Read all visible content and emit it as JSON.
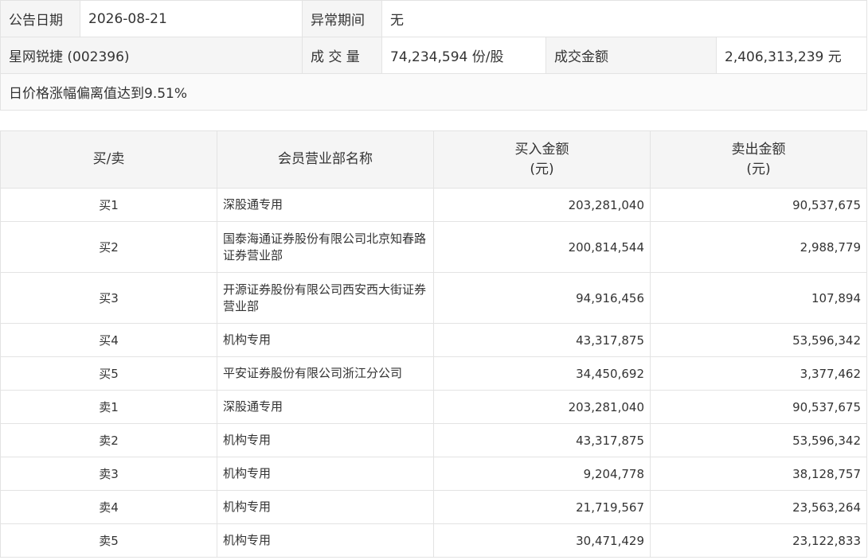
{
  "summary": {
    "date_label": "公告日期",
    "date_value": "2026-08-21",
    "period_label": "异常期间",
    "period_value": "无",
    "stock_name": "星网锐捷 (002396)",
    "volume_label": "成 交 量",
    "volume_value": "74,234,594 份/股",
    "amount_label": "成交金额",
    "amount_value": "2,406,313,239 元",
    "reason": "日价格涨幅偏离值达到9.51%"
  },
  "detail": {
    "headers": {
      "side": "买/卖",
      "name": "会员营业部名称",
      "buy_line1": "买入金额",
      "buy_line2": "(元)",
      "sell_line1": "卖出金额",
      "sell_line2": "(元)"
    },
    "rows": [
      {
        "side": "买1",
        "name": "深股通专用",
        "buy": "203,281,040",
        "sell": "90,537,675"
      },
      {
        "side": "买2",
        "name": "国泰海通证券股份有限公司北京知春路证券营业部",
        "buy": "200,814,544",
        "sell": "2,988,779"
      },
      {
        "side": "买3",
        "name": "开源证券股份有限公司西安西大街证券营业部",
        "buy": "94,916,456",
        "sell": "107,894"
      },
      {
        "side": "买4",
        "name": "机构专用",
        "buy": "43,317,875",
        "sell": "53,596,342"
      },
      {
        "side": "买5",
        "name": "平安证券股份有限公司浙江分公司",
        "buy": "34,450,692",
        "sell": "3,377,462"
      },
      {
        "side": "卖1",
        "name": "深股通专用",
        "buy": "203,281,040",
        "sell": "90,537,675"
      },
      {
        "side": "卖2",
        "name": "机构专用",
        "buy": "43,317,875",
        "sell": "53,596,342"
      },
      {
        "side": "卖3",
        "name": "机构专用",
        "buy": "9,204,778",
        "sell": "38,128,757"
      },
      {
        "side": "卖4",
        "name": "机构专用",
        "buy": "21,719,567",
        "sell": "23,563,264"
      },
      {
        "side": "卖5",
        "name": "机构专用",
        "buy": "30,471,429",
        "sell": "23,122,833"
      }
    ]
  }
}
